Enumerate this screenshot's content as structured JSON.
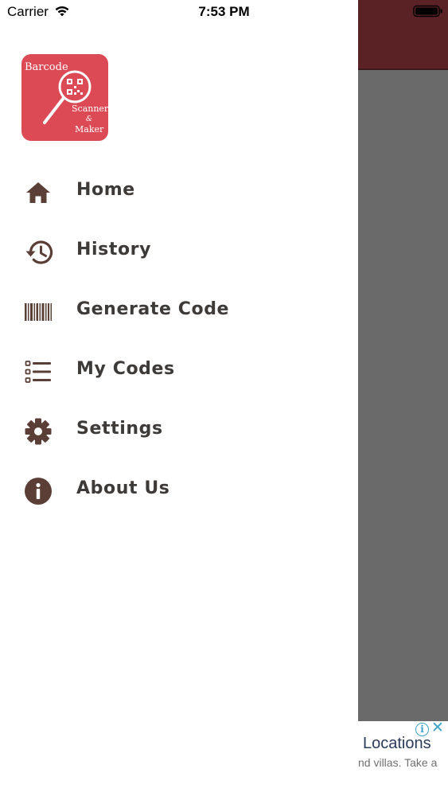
{
  "status_bar": {
    "carrier": "Carrier",
    "time": "7:53 PM",
    "wifi_icon": "wifi-icon",
    "battery_icon": "battery-icon"
  },
  "logo": {
    "line1": "Barcode",
    "line2": "Scanner",
    "line3": "&",
    "line4": "Maker",
    "background_color": "#dc4a55"
  },
  "menu": {
    "icon_color": "#5b3f37",
    "items": [
      {
        "label": "Home",
        "icon": "home-icon"
      },
      {
        "label": "History",
        "icon": "history-icon"
      },
      {
        "label": "Generate Code",
        "icon": "barcode-icon"
      },
      {
        "label": "My Codes",
        "icon": "list-icon"
      },
      {
        "label": "Settings",
        "icon": "gear-icon"
      },
      {
        "label": "About Us",
        "icon": "info-icon"
      }
    ]
  },
  "background_app": {
    "header_color": "#5a2225",
    "ad": {
      "title": "Locations",
      "subtitle": "nd villas. Take a",
      "info_icon": "i",
      "close_icon": "✕"
    }
  }
}
